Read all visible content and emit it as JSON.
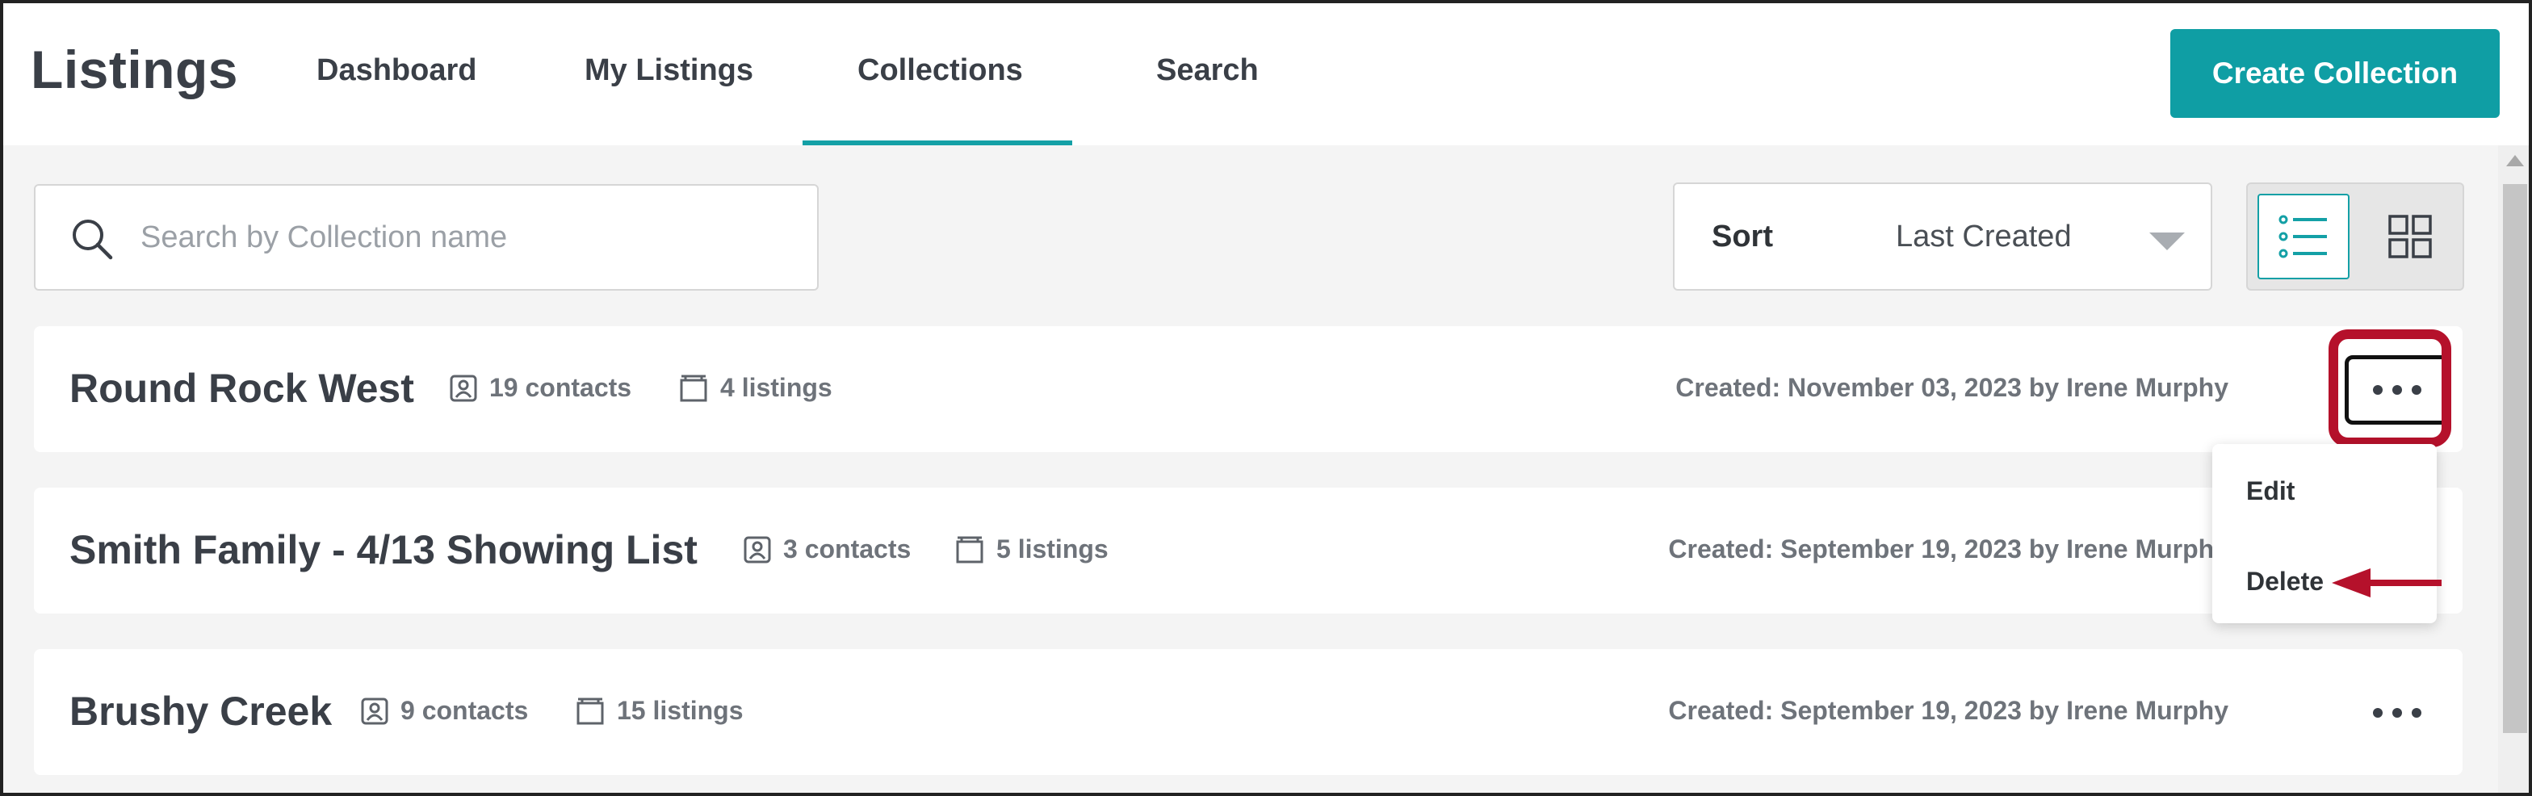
{
  "header": {
    "app_title": "Listings",
    "tabs": [
      {
        "label": "Dashboard"
      },
      {
        "label": "My Listings"
      },
      {
        "label": "Collections"
      },
      {
        "label": "Search"
      }
    ],
    "active_tab": "Collections",
    "create_label": "Create Collection"
  },
  "toolbar": {
    "search_placeholder": "Search by Collection name",
    "sort_label": "Sort",
    "sort_value": "Last Created",
    "view_modes": [
      "list-view-icon",
      "grid-view-icon"
    ],
    "active_view": "list-view-icon"
  },
  "collections": [
    {
      "name": "Round Rock West",
      "contacts": "19 contacts",
      "listings": "4 listings",
      "created": "Created: November 03, 2023 by Irene Murphy"
    },
    {
      "name": "Smith Family - 4/13 Showing List",
      "contacts": "3 contacts",
      "listings": "5 listings",
      "created": "Created: September 19, 2023 by Irene Murphy"
    },
    {
      "name": "Brushy Creek",
      "contacts": "9 contacts",
      "listings": "15 listings",
      "created": "Created: September 19, 2023 by Irene Murphy"
    }
  ],
  "menu": {
    "edit_label": "Edit",
    "delete_label": "Delete"
  },
  "colors": {
    "accent": "#0f9ea4",
    "annotation": "#b5112b"
  }
}
